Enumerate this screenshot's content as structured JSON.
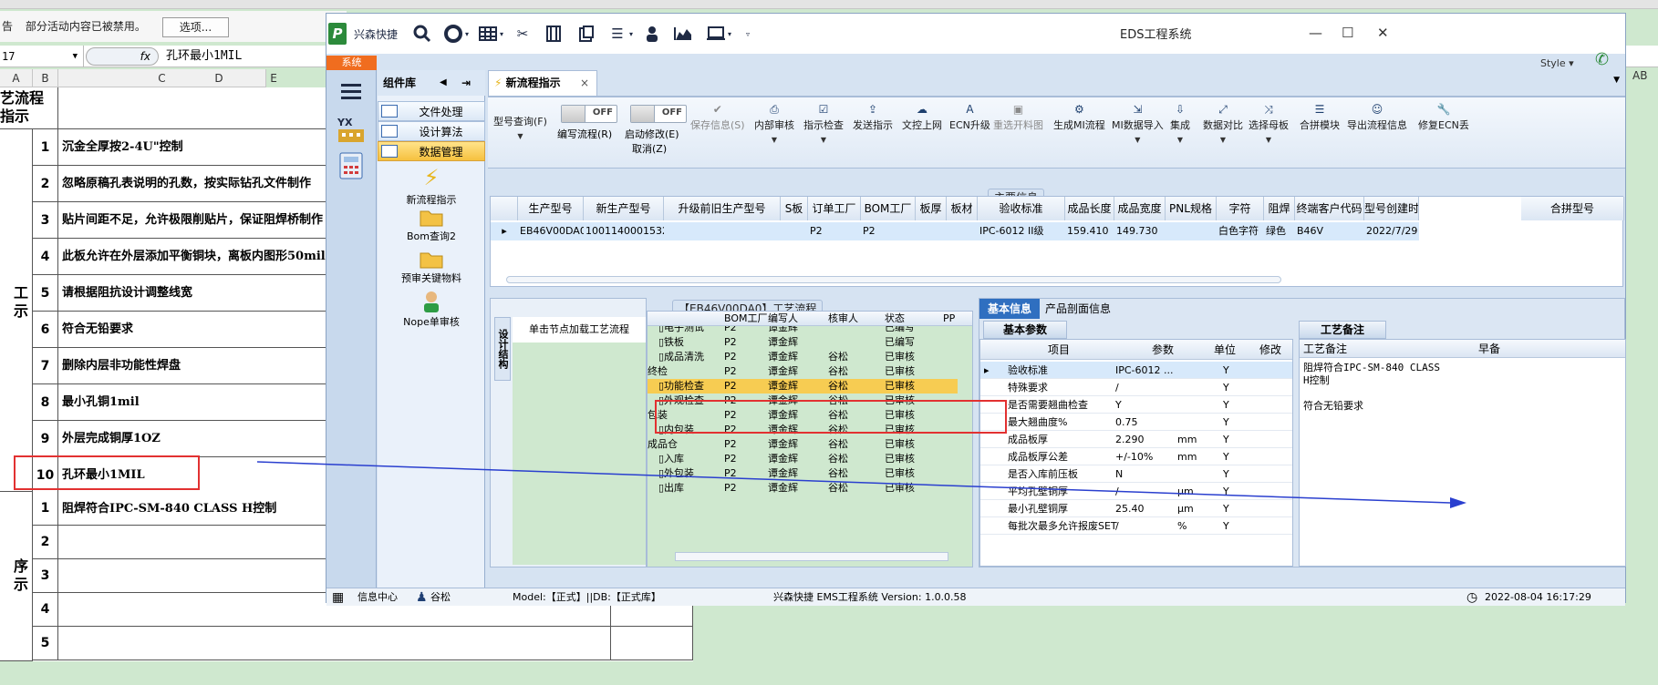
{
  "spreadsheet": {
    "notice_prefix": "告",
    "notice_text": "部分活动内容已被禁用。",
    "options_button": "选项...",
    "name_box": "17",
    "fx": "fx",
    "formula_value": "孔环最小1MIL",
    "columns": [
      "A",
      "B",
      "C",
      "D",
      "E"
    ],
    "far_col": "AB",
    "header_title_l1": "艺流程",
    "header_title_l2": "指示",
    "side_label_1": "工",
    "side_label_1b": "示",
    "side_label_2": "序",
    "side_label_2b": "示",
    "rows_a": [
      {
        "num": "1",
        "text": "沉金全厚按2-4U\"控制"
      },
      {
        "num": "2",
        "text": "忽略原稿孔表说明的孔数，按实际钻孔文件制作"
      },
      {
        "num": "3",
        "text": "贴片间距不足，允许极限削贴片，保证阻焊桥制作"
      },
      {
        "num": "4",
        "text": "此板允许在外层添加平衡铜块，离板内图形50mil"
      },
      {
        "num": "5",
        "text": "请根据阻抗设计调整线宽"
      },
      {
        "num": "6",
        "text": "符合无铅要求"
      },
      {
        "num": "7",
        "text": "删除内层非功能性焊盘"
      },
      {
        "num": "8",
        "text": "最小孔铜1mil"
      },
      {
        "num": "9",
        "text": "外层完成铜厚1OZ"
      },
      {
        "num": "10",
        "text": "孔环最小1MIL"
      }
    ],
    "rows_b": [
      {
        "num": "1",
        "text": "阻焊符合IPC-SM-840 CLASS H控制"
      },
      {
        "num": "2",
        "text": ""
      },
      {
        "num": "3",
        "text": ""
      },
      {
        "num": "4",
        "text": ""
      },
      {
        "num": "5",
        "text": ""
      }
    ]
  },
  "window": {
    "title": "EDS工程系统",
    "app_name": "兴森快捷",
    "sys_tab": "系统",
    "style_label": "Style",
    "lib_title": "组件库",
    "lib_items": [
      "文件处理",
      "设计算法",
      "数据管理"
    ],
    "lib_tools": [
      "新流程指示",
      "Bom查询2",
      "预审关键物料",
      "Nope单审核"
    ],
    "doc_tab": "新流程指示",
    "toggle_off": "OFF",
    "toolbar": {
      "model_query": "型号查询(F)",
      "edit_flow": "编写流程(R)",
      "start_modify": "启动修改(E)",
      "cancel": "取消(Z)",
      "save_info": "保存信息(S)",
      "internal_review": "内部审核",
      "instr_check": "指示检查",
      "send_instr": "发送指示",
      "doc_upload": "文控上网",
      "ecn_upgrade": "ECN升级",
      "regen_img": "重选开料图",
      "gen_mi": "生成MI流程",
      "mi_import": "MI数据导入",
      "integrate": "集成",
      "data_compare": "数据对比",
      "select_parent": "选择母板",
      "merge_module": "合拼模块",
      "export_flow": "导出流程信息",
      "repair_ecn": "修复ECN丢"
    },
    "main_info_title": "主要信息",
    "main_grid_headers": [
      "生产型号",
      "新生产型号",
      "升级前旧生产型号",
      "S板",
      "订单工厂",
      "BOM工厂",
      "板厚",
      "板材",
      "验收标准",
      "成品长度",
      "成品宽度",
      "PNL规格",
      "字符",
      "阻焊",
      "终端客户代码",
      "型号创建时",
      "合拼型号"
    ],
    "main_row": [
      "EB46V00DA0",
      "10011400015324",
      "",
      "",
      "P2",
      "P2",
      "",
      "",
      "IPC-6012 II级",
      "159.410",
      "149.730",
      "",
      "白色字符",
      "绿色",
      "B46V",
      "2022/7/29"
    ],
    "flow_title": "【EB46V00DA0】工艺流程",
    "design_struct": "设计结构",
    "load_flow": "单击节点加载工艺流程",
    "flow_headers": [
      "BOM工厂",
      "编写人",
      "核审人",
      "状态",
      "PP"
    ],
    "flow_rows": [
      [
        "电子测试",
        "P2",
        "谭金辉",
        "",
        "已编写"
      ],
      [
        "铁板",
        "P2",
        "谭金辉",
        "",
        "已编写"
      ],
      [
        "成品清洗",
        "P2",
        "谭金辉",
        "谷松",
        "已审核"
      ],
      [
        "终检",
        "P2",
        "谭金辉",
        "谷松",
        "已审核"
      ],
      [
        "功能检查",
        "P2",
        "谭金辉",
        "谷松",
        "已审核"
      ],
      [
        "外观检查",
        "P2",
        "谭金辉",
        "谷松",
        "已审核"
      ],
      [
        "包装",
        "P2",
        "谭金辉",
        "谷松",
        "已审核"
      ],
      [
        "内包装",
        "P2",
        "谭金辉",
        "谷松",
        "已审核"
      ],
      [
        "成品仓",
        "P2",
        "谭金辉",
        "谷松",
        "已审核"
      ],
      [
        "入库",
        "P2",
        "谭金辉",
        "谷松",
        "已审核"
      ],
      [
        "外包装",
        "P2",
        "谭金辉",
        "谷松",
        "已审核"
      ],
      [
        "出库",
        "P2",
        "谭金辉",
        "谷松",
        "已审核"
      ]
    ],
    "info_tabs": [
      "基本信息",
      "产品剖面信息"
    ],
    "basic_params": "基本参数",
    "param_headers": [
      "项目",
      "参数",
      "单位",
      "修改"
    ],
    "param_rows": [
      [
        "验收标准",
        "IPC-6012 ...",
        "",
        "Y"
      ],
      [
        "特殊要求",
        "/",
        "",
        "Y"
      ],
      [
        "是否需要翘曲检查",
        "Y",
        "",
        "Y"
      ],
      [
        "最大翘曲度%",
        "0.75",
        "",
        "Y"
      ],
      [
        "成品板厚",
        "2.290",
        "mm",
        "Y"
      ],
      [
        "成品板厚公差",
        "+/-10%",
        "mm",
        "Y"
      ],
      [
        "是否入库前压板",
        "N",
        "",
        "Y"
      ],
      [
        "平均孔壁铜厚",
        "/",
        "μm",
        "Y"
      ],
      [
        "最小孔壁铜厚",
        "25.40",
        "μm",
        "Y"
      ],
      [
        "每批次最多允许报废SET",
        "/",
        "%",
        "Y"
      ]
    ],
    "remark_tab": "工艺备注",
    "remark_head": "工艺备注",
    "remark_head2": "早备",
    "remark_line1": "阻焊符合IPC-SM-840 CLASS H控制",
    "remark_line2": "符合无铅要求",
    "status": {
      "info_center": "信息中心",
      "user": "谷松",
      "model": "Model:【正式】||DB:【正式库】",
      "version": "兴森快捷 EMS工程系统 Version: 1.0.0.58",
      "datetime": "2022-08-04 16:17:29"
    }
  }
}
